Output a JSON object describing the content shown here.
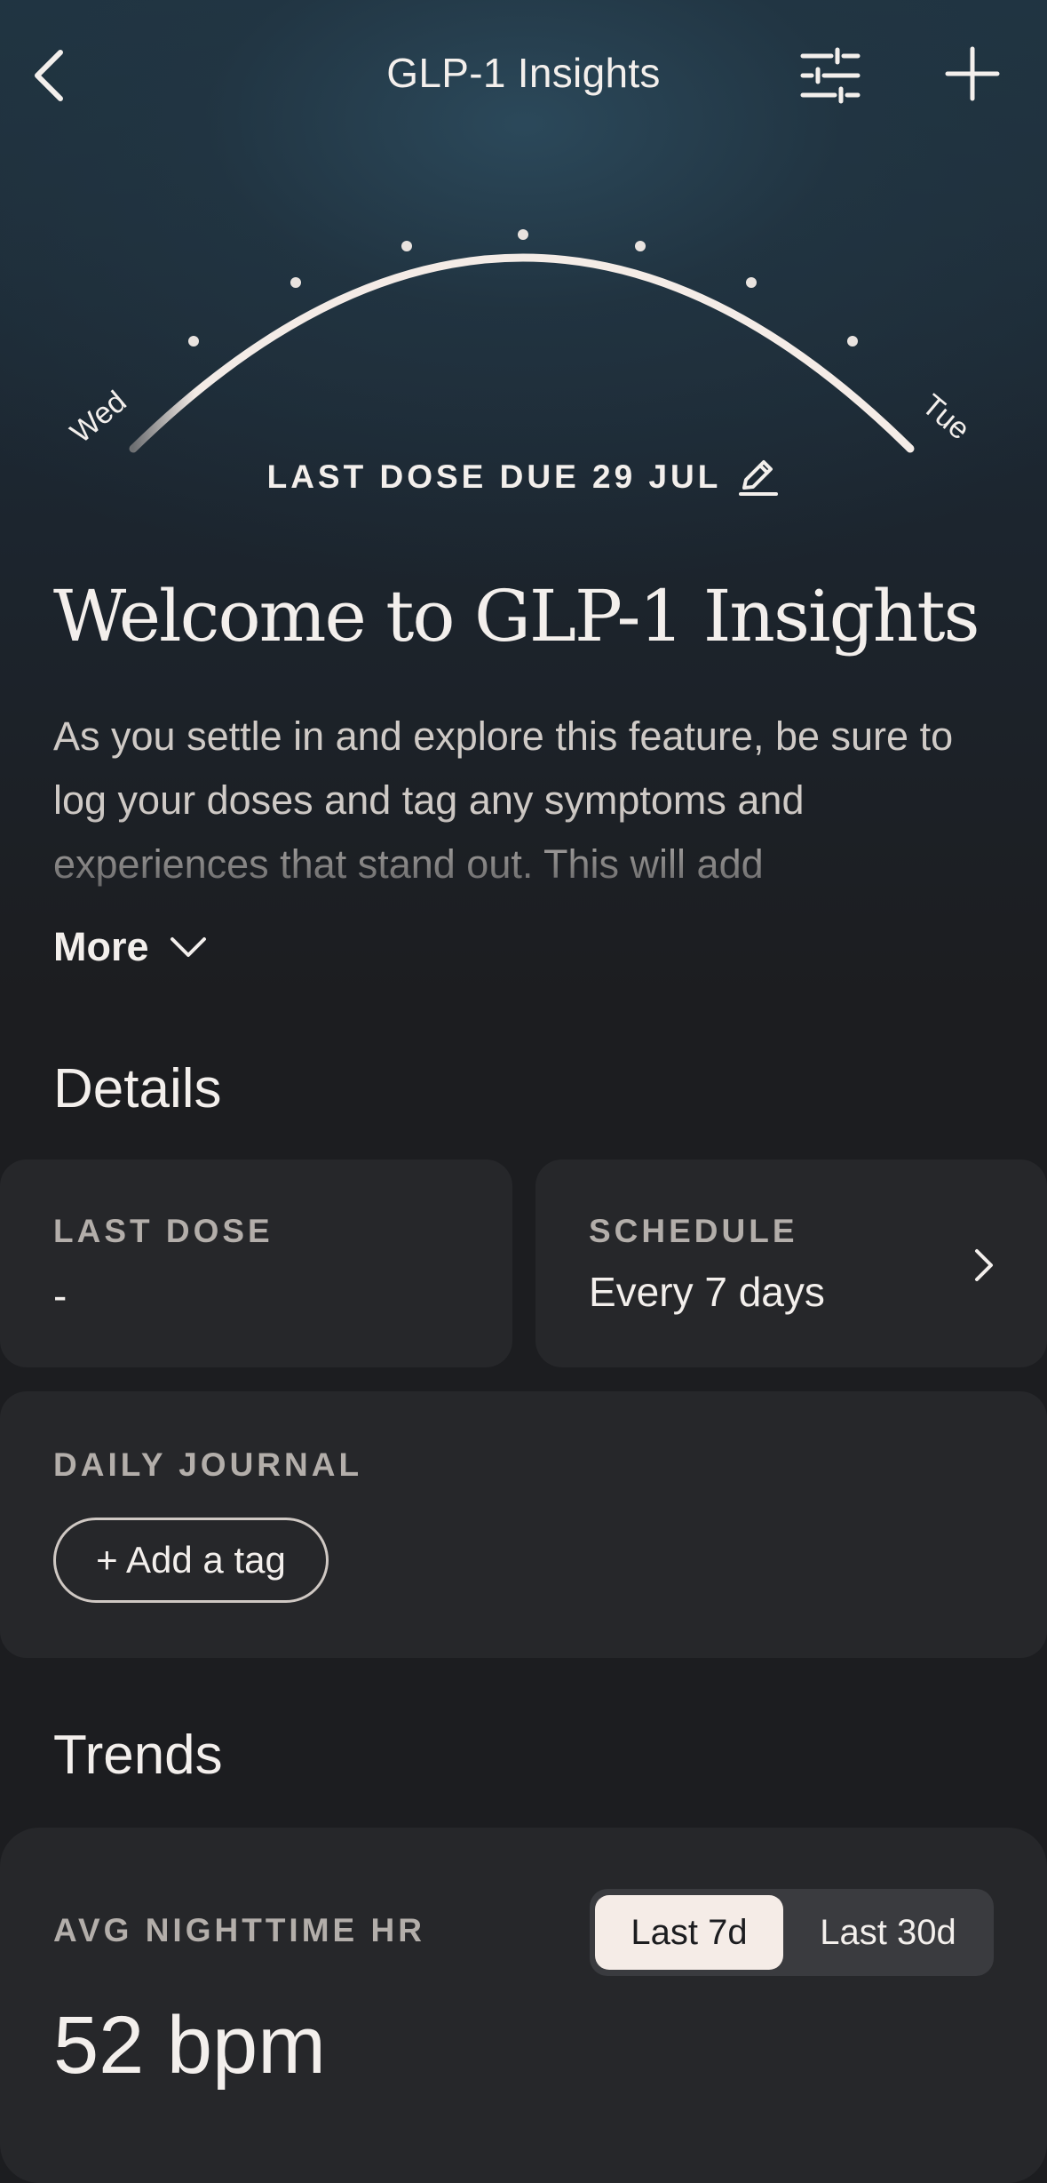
{
  "header": {
    "title": "GLP-1 Insights",
    "back_icon": "chevron-left-icon",
    "filter_icon": "sliders-icon",
    "add_icon": "plus-icon"
  },
  "dose_arc": {
    "start_day": "Wed",
    "end_day": "Tue",
    "progress": 1.0,
    "due_label": "LAST DOSE DUE 29 JUL",
    "edit_icon": "pencil-icon"
  },
  "intro": {
    "title": "Welcome to GLP-1 Insights",
    "description": "As you settle in and explore this feature, be sure to log your doses and tag any symptoms and experiences that stand out. This will add",
    "more_label": "More"
  },
  "details": {
    "title": "Details",
    "last_dose": {
      "label": "LAST DOSE",
      "value": "-"
    },
    "schedule": {
      "label": "SCHEDULE",
      "value": "Every 7 days"
    },
    "journal": {
      "label": "DAILY JOURNAL",
      "add_tag": "+ Add a tag"
    }
  },
  "trends": {
    "title": "Trends",
    "metric_label": "AVG NIGHTTIME HR",
    "range_options": [
      "Last 7d",
      "Last 30d"
    ],
    "selected_range": "Last 7d",
    "value": "52 bpm"
  },
  "colors": {
    "background": "#1c1d20",
    "card": "#26272a",
    "text": "#f3efec",
    "accent": "#f5ece7"
  }
}
